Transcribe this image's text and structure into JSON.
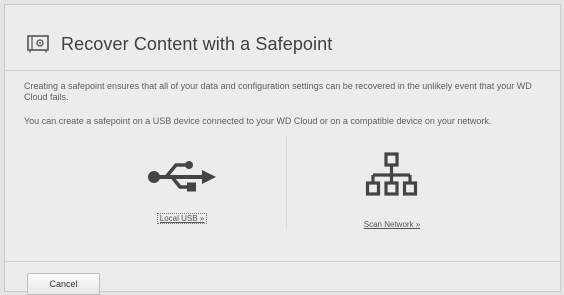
{
  "dialog": {
    "title": "Recover Content with a Safepoint",
    "title_icon": "safepoint-drive-icon",
    "description": "Creating a safepoint ensures that all of your data and configuration settings can be recovered in the unlikely event that your WD Cloud fails.",
    "instruction": "You can create a safepoint on a USB device connected to your WD Cloud or on a compatible device on your network.",
    "options": [
      {
        "icon": "usb-icon",
        "link_label": "Local USB »"
      },
      {
        "icon": "network-icon",
        "link_label": "Scan Network »"
      }
    ],
    "cancel_label": "Cancel"
  },
  "colors": {
    "background": "#ececec",
    "icon": "#444444",
    "text": "#5e5e5e"
  }
}
